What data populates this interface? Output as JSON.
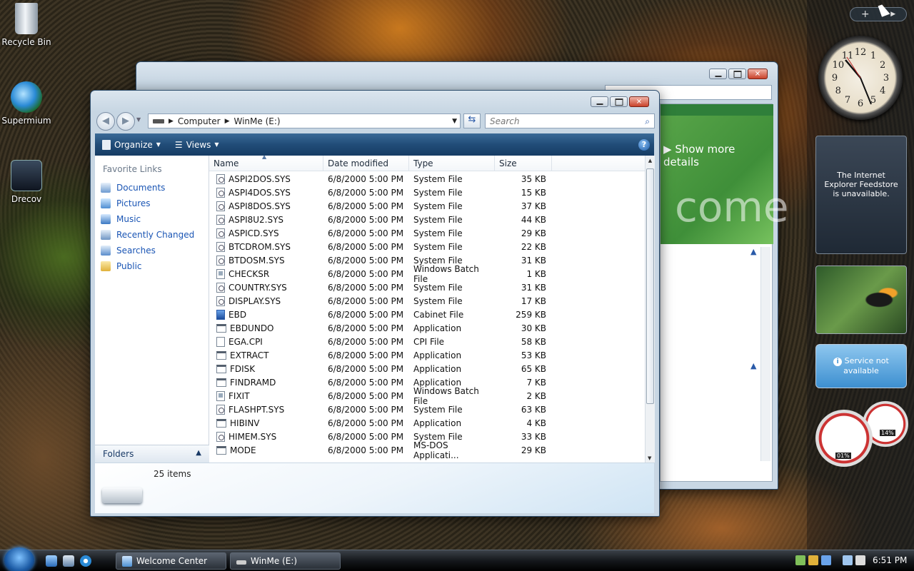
{
  "desktop": {
    "icons": [
      {
        "label": "Recycle Bin"
      },
      {
        "label": "Supermium"
      },
      {
        "label": "Drecov"
      }
    ]
  },
  "back_window": {
    "link": "Show more details",
    "watermark": "come"
  },
  "explorer": {
    "address": {
      "segments": [
        "Computer",
        "WinMe (E:)"
      ]
    },
    "search": {
      "placeholder": "Search"
    },
    "toolbar": {
      "organize": "Organize",
      "views": "Views",
      "help": "?"
    },
    "nav": {
      "heading": "Favorite Links",
      "links": [
        "Documents",
        "Pictures",
        "Music",
        "Recently Changed",
        "Searches",
        "Public"
      ],
      "folders": "Folders"
    },
    "columns": [
      "Name",
      "Date modified",
      "Type",
      "Size"
    ],
    "rows": [
      {
        "name": "ASPI2DOS.SYS",
        "date": "6/8/2000 5:00 PM",
        "type": "System File",
        "size": "35 KB",
        "icon": "sys"
      },
      {
        "name": "ASPI4DOS.SYS",
        "date": "6/8/2000 5:00 PM",
        "type": "System File",
        "size": "15 KB",
        "icon": "sys"
      },
      {
        "name": "ASPI8DOS.SYS",
        "date": "6/8/2000 5:00 PM",
        "type": "System File",
        "size": "37 KB",
        "icon": "sys"
      },
      {
        "name": "ASPI8U2.SYS",
        "date": "6/8/2000 5:00 PM",
        "type": "System File",
        "size": "44 KB",
        "icon": "sys"
      },
      {
        "name": "ASPICD.SYS",
        "date": "6/8/2000 5:00 PM",
        "type": "System File",
        "size": "29 KB",
        "icon": "sys"
      },
      {
        "name": "BTCDROM.SYS",
        "date": "6/8/2000 5:00 PM",
        "type": "System File",
        "size": "22 KB",
        "icon": "sys"
      },
      {
        "name": "BTDOSM.SYS",
        "date": "6/8/2000 5:00 PM",
        "type": "System File",
        "size": "31 KB",
        "icon": "sys"
      },
      {
        "name": "CHECKSR",
        "date": "6/8/2000 5:00 PM",
        "type": "Windows Batch File",
        "size": "1 KB",
        "icon": "bat"
      },
      {
        "name": "COUNTRY.SYS",
        "date": "6/8/2000 5:00 PM",
        "type": "System File",
        "size": "31 KB",
        "icon": "sys"
      },
      {
        "name": "DISPLAY.SYS",
        "date": "6/8/2000 5:00 PM",
        "type": "System File",
        "size": "17 KB",
        "icon": "sys"
      },
      {
        "name": "EBD",
        "date": "6/8/2000 5:00 PM",
        "type": "Cabinet File",
        "size": "259 KB",
        "icon": "cab"
      },
      {
        "name": "EBDUNDO",
        "date": "6/8/2000 5:00 PM",
        "type": "Application",
        "size": "30 KB",
        "icon": "app"
      },
      {
        "name": "EGA.CPI",
        "date": "6/8/2000 5:00 PM",
        "type": "CPI File",
        "size": "58 KB",
        "icon": "blank"
      },
      {
        "name": "EXTRACT",
        "date": "6/8/2000 5:00 PM",
        "type": "Application",
        "size": "53 KB",
        "icon": "app"
      },
      {
        "name": "FDISK",
        "date": "6/8/2000 5:00 PM",
        "type": "Application",
        "size": "65 KB",
        "icon": "app"
      },
      {
        "name": "FINDRAMD",
        "date": "6/8/2000 5:00 PM",
        "type": "Application",
        "size": "7 KB",
        "icon": "app"
      },
      {
        "name": "FIXIT",
        "date": "6/8/2000 5:00 PM",
        "type": "Windows Batch File",
        "size": "2 KB",
        "icon": "bat"
      },
      {
        "name": "FLASHPT.SYS",
        "date": "6/8/2000 5:00 PM",
        "type": "System File",
        "size": "63 KB",
        "icon": "sys"
      },
      {
        "name": "HIBINV",
        "date": "6/8/2000 5:00 PM",
        "type": "Application",
        "size": "4 KB",
        "icon": "app"
      },
      {
        "name": "HIMEM.SYS",
        "date": "6/8/2000 5:00 PM",
        "type": "System File",
        "size": "33 KB",
        "icon": "sys"
      },
      {
        "name": "MODE",
        "date": "6/8/2000 5:00 PM",
        "type": "MS-DOS Applicati...",
        "size": "29 KB",
        "icon": "app"
      }
    ],
    "status": "25 items"
  },
  "taskbar": {
    "tasks": [
      "Welcome Center",
      "WinMe (E:)"
    ],
    "clock": "6:51 PM"
  },
  "sidebar": {
    "feed_message": "The Internet Explorer Feedstore is unavailable.",
    "service_message": "Service not available",
    "cpu": "01%",
    "mem": "14%",
    "clock_numbers": [
      "12",
      "1",
      "2",
      "3",
      "4",
      "5",
      "6",
      "7",
      "8",
      "9",
      "10",
      "11"
    ]
  }
}
